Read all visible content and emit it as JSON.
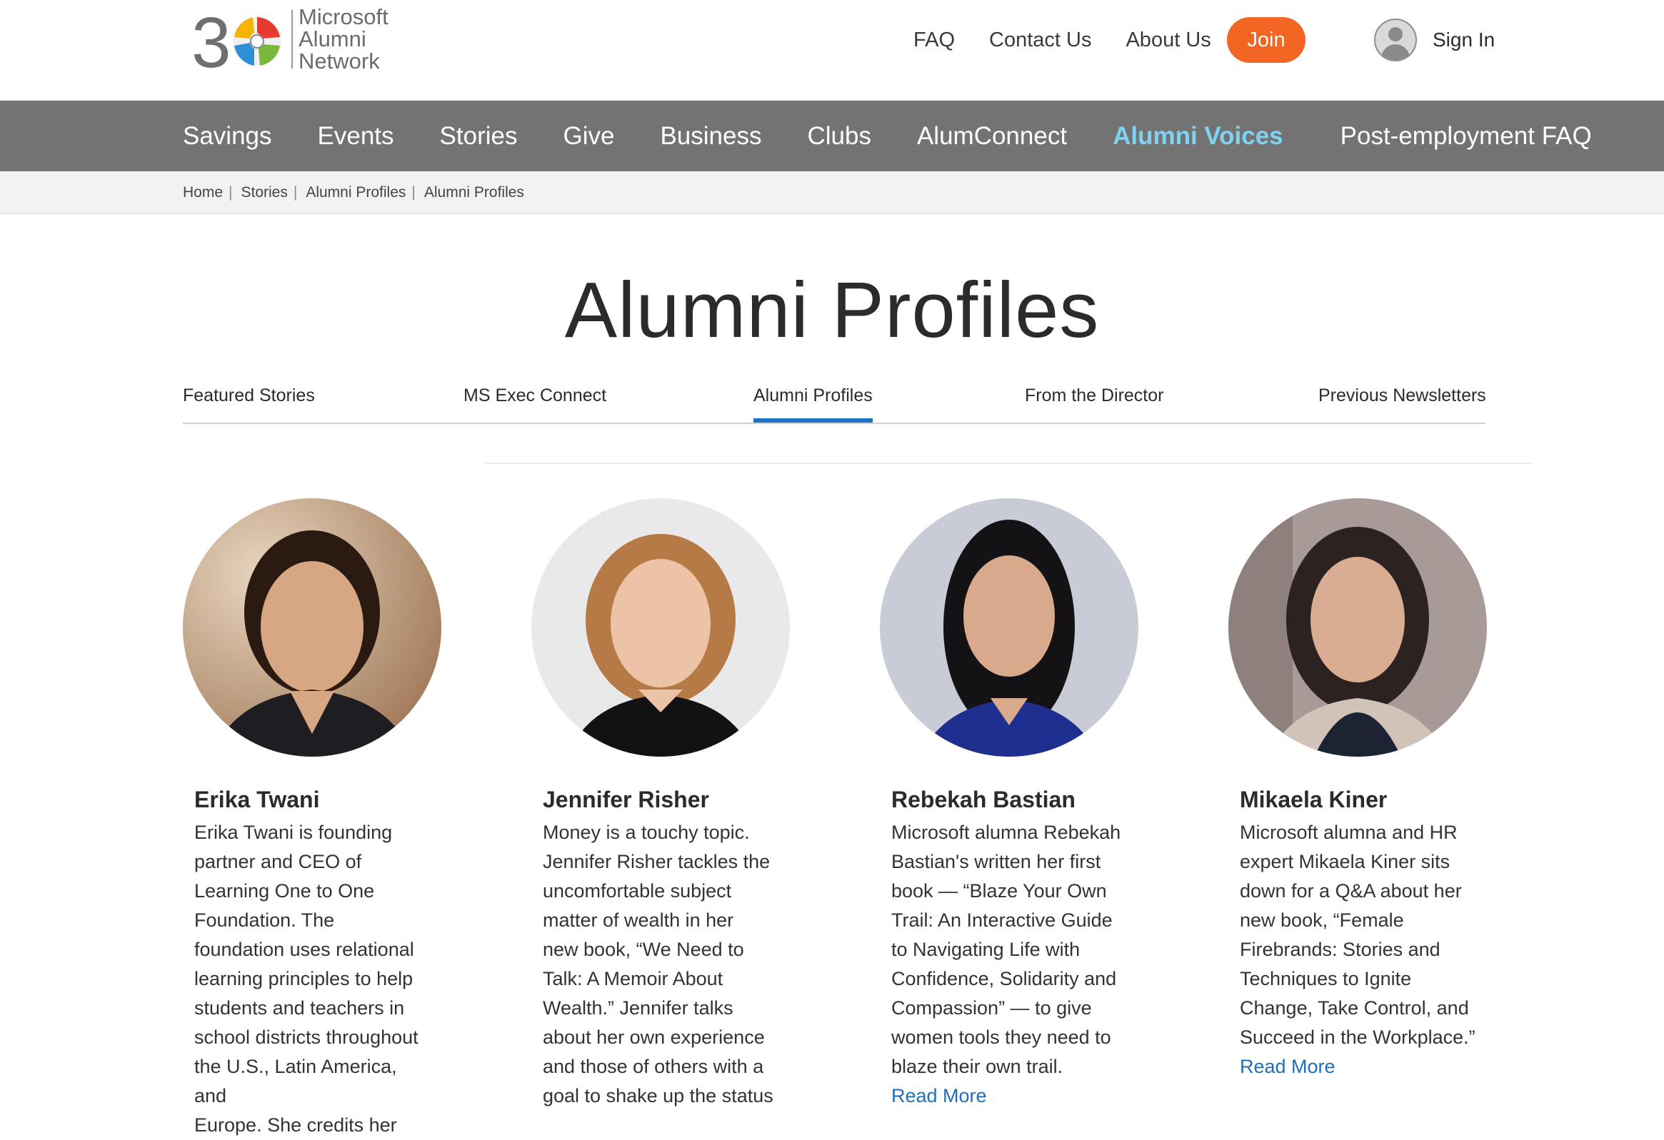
{
  "logo": {
    "number": "30",
    "line1": "Microsoft",
    "line2": "Alumni",
    "line3": "Network"
  },
  "top_links": [
    "FAQ",
    "Contact Us",
    "About Us"
  ],
  "join_label": "Join",
  "signin_label": "Sign In",
  "main_nav": [
    "Savings",
    "Events",
    "Stories",
    "Give",
    "Business",
    "Clubs",
    "AlumConnect",
    "Alumni Voices",
    "Post-employment FAQ"
  ],
  "main_nav_active": "Alumni Voices",
  "breadcrumb": [
    "Home",
    "Stories",
    "Alumni Profiles",
    "Alumni Profiles"
  ],
  "page_title": "Alumni Profiles",
  "tabs": [
    "Featured Stories",
    "MS Exec Connect",
    "Alumni Profiles",
    "From the Director",
    "Previous Newsletters"
  ],
  "active_tab": "Alumni Profiles",
  "profiles": [
    {
      "name": "Erika Twani",
      "lines": [
        "Erika Twani is founding",
        "partner and CEO of",
        "Learning One to One",
        "Foundation. The",
        "foundation uses relational",
        "learning principles to help",
        "students and teachers in",
        "school districts throughout",
        "the U.S., Latin America, and",
        "Europe. She credits her"
      ],
      "read_more": ""
    },
    {
      "name": "Jennifer Risher",
      "lines": [
        "Money is a touchy topic.",
        "Jennifer Risher tackles the",
        "uncomfortable subject",
        "matter of wealth in her",
        "new book, “We Need to",
        "Talk: A Memoir About",
        "Wealth.” Jennifer talks",
        "about her own experience",
        "and those of others with a",
        "goal to shake up the status"
      ],
      "read_more": ""
    },
    {
      "name": "Rebekah Bastian",
      "lines": [
        "Microsoft alumna Rebekah",
        "Bastian's written her first",
        "book — “Blaze Your Own",
        "Trail: An Interactive Guide",
        "to Navigating Life with",
        "Confidence, Solidarity and",
        "Compassion” — to give",
        "women tools they need to",
        "blaze their own trail."
      ],
      "read_more": "Read More"
    },
    {
      "name": "Mikaela Kiner",
      "lines": [
        "Microsoft alumna and HR",
        "expert Mikaela Kiner sits",
        "down for a Q&A about her",
        "new book, “Female",
        "Firebrands: Stories and",
        "Techniques to Ignite",
        "Change, Take Control, and",
        "Succeed in the Workplace.”"
      ],
      "read_more": "Read More"
    }
  ],
  "colors": {
    "nav_bg": "#737373",
    "nav_active": "#7fd3f2",
    "join": "#f26522",
    "link": "#1f6fb8",
    "tab_underline": "#1a73c7"
  }
}
